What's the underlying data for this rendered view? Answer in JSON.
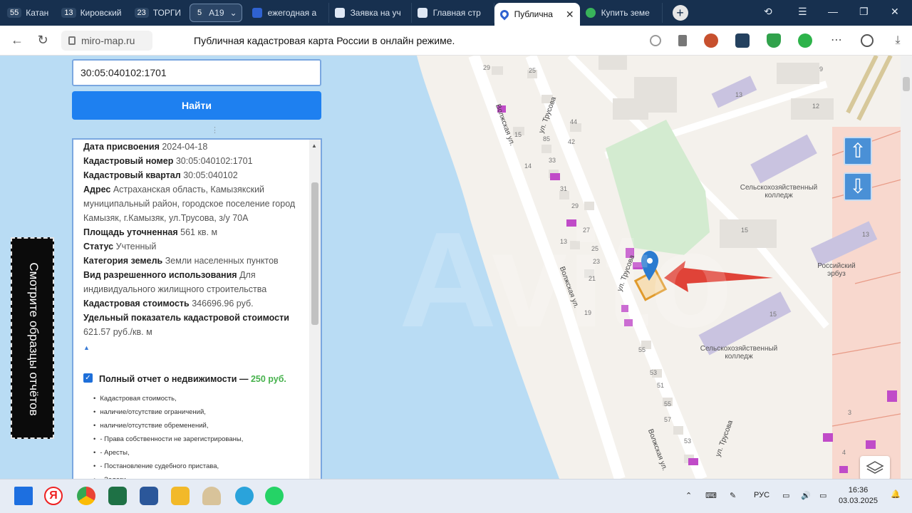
{
  "browser": {
    "tab_groups": [
      {
        "count": "55",
        "label": "Катан"
      },
      {
        "count": "13",
        "label": "Кировский"
      },
      {
        "count": "23",
        "label": "ТОРГИ"
      },
      {
        "count": "5",
        "label": "А19"
      }
    ],
    "tabs": [
      {
        "label": "ежегодная а",
        "color": "#2f62d1"
      },
      {
        "label": "Заявка на уч",
        "color": "#dfe8f5"
      },
      {
        "label": "Главная стр",
        "color": "#dfe8f5"
      },
      {
        "label": "Публична",
        "color": "#2f62d1",
        "active": true
      },
      {
        "label": "Купить земе",
        "color": "#38b35a"
      }
    ],
    "new_tab": "+",
    "url": "miro-map.ru",
    "page_title": "Публичная кадастровая карта России в онлайн режиме."
  },
  "search": {
    "value": "30:05:040102:1701",
    "button": "Найти"
  },
  "info": {
    "rows": [
      {
        "label": "Дата присвоения",
        "value": "2024-04-18"
      },
      {
        "label": "Кадастровый номер",
        "value": "30:05:040102:1701"
      },
      {
        "label": "Кадастровый квартал",
        "value": "30:05:040102"
      },
      {
        "label": "Адрес",
        "value": "Астраханская область, Камызякский муниципальный район, городское поселение город Камызяк, г.Камызяк, ул.Трусова, з/у 70А"
      },
      {
        "label": "Площадь уточненная",
        "value": "561 кв. м"
      },
      {
        "label": "Статус",
        "value": "Учтенный"
      },
      {
        "label": "Категория земель",
        "value": "Земли населенных пунктов"
      },
      {
        "label": "Вид разрешенного использования",
        "value": "Для индивидуального жилищного строительства"
      },
      {
        "label": "Кадастровая стоимость",
        "value": "346696.96 руб."
      },
      {
        "label": "Удельный показатель кадастровой стоимости",
        "value": "621.57 руб./кв. м"
      }
    ],
    "report_title": "Полный отчет о недвижимости —",
    "report_price": "250 руб.",
    "report_items": [
      "Кадастровая стоимость,",
      "наличие/отсутствие ограничений,",
      "наличие/отсутствие обременений,",
      "- Права собственности не зарегистрированы,",
      "- Аресты,",
      "- Постановление судебного пристава,",
      "- Залоги,"
    ]
  },
  "banner": "Смотрите образцы отчётов",
  "map": {
    "streets": [
      "Волжская ул.",
      "ул. Трусова",
      "Волжская ул.",
      "ул. Трусова",
      "Волжская ул.",
      "ул. Трусова"
    ],
    "pois": [
      "Сельскохозяйственный колледж",
      "Российский эрбуз",
      "Сельскохозяйственный колледж"
    ],
    "house_numbers": [
      "29",
      "25",
      "15",
      "85",
      "44",
      "42",
      "13",
      "9",
      "14",
      "33",
      "31",
      "29",
      "27",
      "25",
      "13",
      "23",
      "21",
      "19",
      "55",
      "53",
      "51",
      "55",
      "57",
      "53",
      "15",
      "15",
      "13",
      "12",
      "3",
      "4"
    ]
  },
  "taskbar": {
    "lang": "РУС",
    "time": "16:36",
    "date": "03.03.2025"
  }
}
